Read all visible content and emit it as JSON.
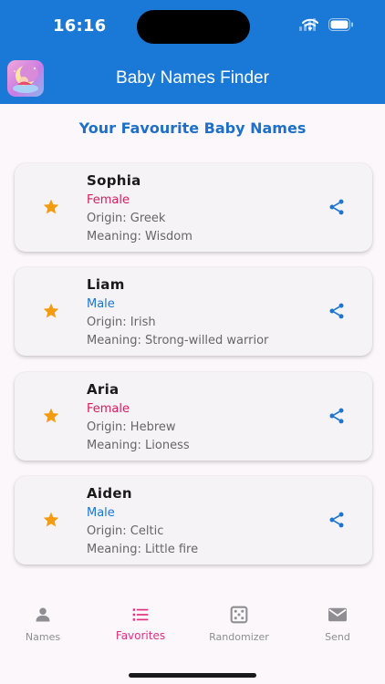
{
  "status_bar": {
    "time": "16:16"
  },
  "header": {
    "title": "Baby Names Finder",
    "app_icon": "baby-moon-app-icon"
  },
  "section_title": "Your Favourite Baby Names",
  "colors": {
    "header": "#1a78d6",
    "title_blue": "#1d6fc9",
    "female": "#d81b60",
    "male": "#1976d2",
    "star": "#f39c12",
    "active_tab": "#e0307e"
  },
  "favorites": [
    {
      "name": "Sophia",
      "gender": "Female",
      "origin": "Origin: Greek",
      "meaning": "Meaning: Wisdom"
    },
    {
      "name": "Liam",
      "gender": "Male",
      "origin": "Origin: Irish",
      "meaning": "Meaning: Strong-willed warrior"
    },
    {
      "name": "Aria",
      "gender": "Female",
      "origin": "Origin: Hebrew",
      "meaning": "Meaning: Lioness"
    },
    {
      "name": "Aiden",
      "gender": "Male",
      "origin": "Origin: Celtic",
      "meaning": "Meaning: Little fire"
    }
  ],
  "tabbar": {
    "active": "favorites",
    "items": [
      {
        "id": "names",
        "label": "Names",
        "icon": "person-icon"
      },
      {
        "id": "favorites",
        "label": "Favorites",
        "icon": "list-icon"
      },
      {
        "id": "randomizer",
        "label": "Randomizer",
        "icon": "dice-icon"
      },
      {
        "id": "send",
        "label": "Send",
        "icon": "mail-icon"
      }
    ]
  }
}
